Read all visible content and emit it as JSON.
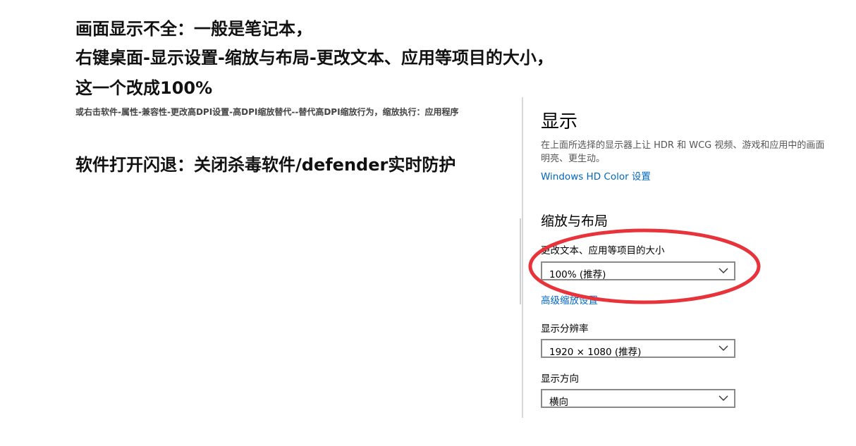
{
  "notes": {
    "line1": "画面显示不全：一般是笔记本，",
    "line2": "右键桌面-显示设置-缩放与布局-更改文本、应用等项目的大小，",
    "line3": "这一个改成100%",
    "small": "或右击软件-属性-兼容性-更改高DPI设置-高DPI缩放替代--替代高DPI缩放行为，缩放执行：应用程序",
    "line4": "软件打开闪退：关闭杀毒软件/defender实时防护"
  },
  "settings": {
    "title": "显示",
    "description_line1": "在上面所选择的显示器上让 HDR 和 WCG 视频、游戏和应用中的画面",
    "description_line2": "明亮、更生动。",
    "hdr_link": "Windows HD Color 设置",
    "scale_section": "缩放与布局",
    "scale_label": "更改文本、应用等项目的大小",
    "scale_value": "100% (推荐)",
    "advanced_link": "高级缩放设置",
    "resolution_label": "显示分辨率",
    "resolution_value": "1920 × 1080 (推荐)",
    "orientation_label": "显示方向",
    "orientation_value": "横向"
  },
  "colors": {
    "annotation": "#e8333a",
    "link": "#0067c0"
  },
  "icons": {
    "dropdown": "chevron-down-icon"
  }
}
